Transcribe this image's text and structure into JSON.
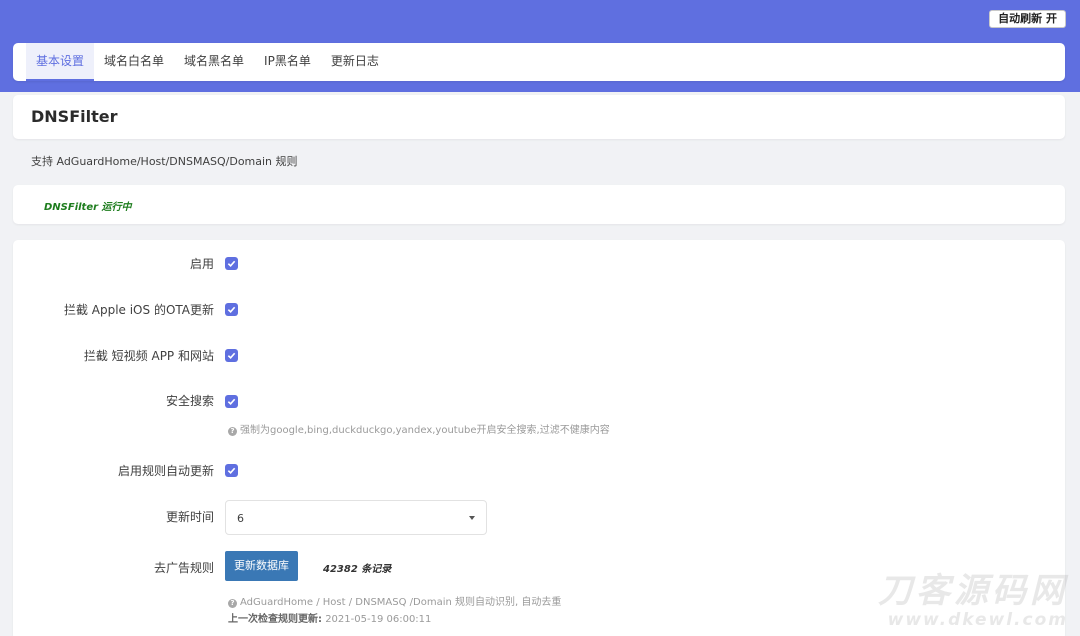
{
  "header": {
    "refresh_button": "自动刷新 开"
  },
  "tabs": [
    {
      "label": "基本设置",
      "active": true
    },
    {
      "label": "域名白名单",
      "active": false
    },
    {
      "label": "域名黑名单",
      "active": false
    },
    {
      "label": "IP黑名单",
      "active": false
    },
    {
      "label": "更新日志",
      "active": false
    }
  ],
  "page": {
    "title": "DNSFilter",
    "description": "支持 AdGuardHome/Host/DNSMASQ/Domain 规则",
    "status": "DNSFilter 运行中"
  },
  "form": {
    "enable": {
      "label": "启用",
      "checked": true
    },
    "block_ios_ota": {
      "label": "拦截 Apple iOS 的OTA更新",
      "checked": true
    },
    "block_short_video": {
      "label": "拦截 短视频 APP 和网站",
      "checked": true
    },
    "safe_search": {
      "label": "安全搜索",
      "checked": true,
      "help": "强制为google,bing,duckduckgo,yandex,youtube开启安全搜索,过滤不健康内容"
    },
    "auto_update": {
      "label": "启用规则自动更新",
      "checked": true
    },
    "update_time": {
      "label": "更新时间",
      "value": "6"
    },
    "ad_rules": {
      "label": "去广告规则",
      "button": "更新数据库",
      "count": "42382 条记录",
      "help": "AdGuardHome / Host / DNSMASQ /Domain 规则自动识别, 自动去重",
      "last_check_label": "上一次检查规则更新:",
      "last_check_time": "2021-05-19 06:00:11"
    }
  },
  "watermark": {
    "title": "刀客源码网",
    "url": "www.dkewl.com"
  },
  "colors": {
    "accent": "#5f6fe0",
    "status_green": "#1e7d1e",
    "button_blue": "#3a78b5"
  }
}
